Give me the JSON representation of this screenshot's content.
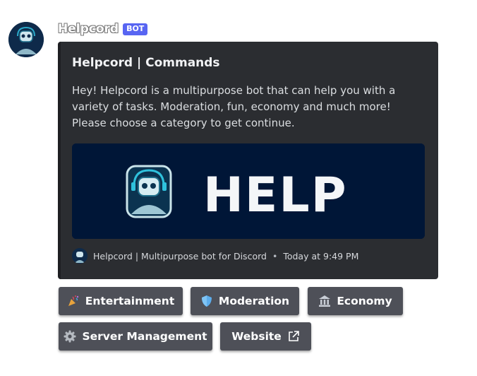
{
  "message": {
    "author": "Helpcord",
    "bot_tag": "BOT"
  },
  "embed": {
    "title": "Helpcord | Commands",
    "description": "Hey! Helpcord is a multipurpose bot that can help you with a variety of tasks. Moderation, fun, economy and much more! Please choose a category to get continue.",
    "image_text": "HELP",
    "footer_text": "Helpcord | Multipurpose bot for Discord",
    "footer_separator": "•",
    "timestamp": "Today at 9:49 PM"
  },
  "buttons": [
    {
      "label": "Entertainment",
      "icon": "party-popper-icon"
    },
    {
      "label": "Moderation",
      "icon": "shield-icon"
    },
    {
      "label": "Economy",
      "icon": "bank-icon"
    },
    {
      "label": "Server Management",
      "icon": "gear-icon"
    },
    {
      "label": "Website",
      "icon": "external-link-icon"
    }
  ],
  "colors": {
    "embed_bg": "#2b2d31",
    "button_bg": "#4e5058",
    "bot_tag": "#5865f2",
    "banner_bg": "#001637"
  }
}
